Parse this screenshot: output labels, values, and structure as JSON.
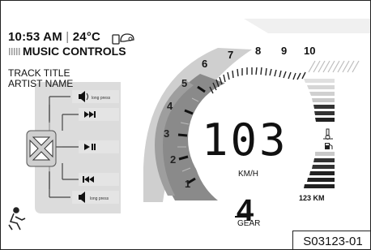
{
  "status": {
    "time": "10:53 AM",
    "separator": "|",
    "temperature": "24°C"
  },
  "music": {
    "title": "MUSIC CONTROLS",
    "track_title": "TRACK TITLE",
    "artist_name": "ARTIST NAME",
    "long_press_label": "long press"
  },
  "tachometer": {
    "scale": [
      "1",
      "2",
      "3",
      "4",
      "5",
      "6",
      "7",
      "8",
      "9",
      "10"
    ]
  },
  "speed": {
    "value": "103",
    "unit": "KM/H"
  },
  "gear": {
    "value": "4",
    "label": "GEAR"
  },
  "fuel": {
    "range": "123 KM"
  },
  "code": "S03123-01",
  "icons": [
    "phone-icon",
    "helmet-icon",
    "volume-up-icon",
    "next-track-icon",
    "play-pause-icon",
    "previous-track-icon",
    "volume-down-icon",
    "temperature-icon",
    "fuel-icon",
    "rider-icon",
    "joystick-icon"
  ]
}
